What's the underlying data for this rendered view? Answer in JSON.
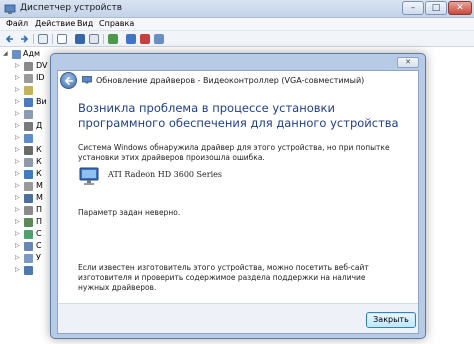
{
  "background_window": {
    "title": "Диспетчер устройств",
    "window_buttons": {
      "minimize": "–",
      "maximize": "□",
      "close": "✕"
    },
    "menu": [
      "Файл",
      "Действие",
      "Вид",
      "Справка"
    ],
    "tree": [
      {
        "label": "Адм",
        "expander": "◢"
      },
      {
        "label": "DV",
        "expander": "▷"
      },
      {
        "label": "ID",
        "expander": "▷"
      },
      {
        "label": "",
        "expander": "▷"
      },
      {
        "label": "Ви",
        "expander": "▷"
      },
      {
        "label": "",
        "expander": "▷"
      },
      {
        "label": "Д",
        "expander": "▷"
      },
      {
        "label": "",
        "expander": "▷"
      },
      {
        "label": "К",
        "expander": "▷"
      },
      {
        "label": "К",
        "expander": "▷"
      },
      {
        "label": "К",
        "expander": "▷"
      },
      {
        "label": "М",
        "expander": "▷"
      },
      {
        "label": "М",
        "expander": "▷"
      },
      {
        "label": "П",
        "expander": "▷"
      },
      {
        "label": "П",
        "expander": "▷"
      },
      {
        "label": "С",
        "expander": "▷"
      },
      {
        "label": "С",
        "expander": "▷"
      },
      {
        "label": "У",
        "expander": "▷"
      },
      {
        "label": "",
        "expander": "▷"
      }
    ]
  },
  "dialog": {
    "close_glyph": "✕",
    "caption": "Обновление драйверов - Видеоконтроллер (VGA-совместимый)",
    "main_instruction": "Возникла проблема в процессе установки программного обеспечения для данного устройства",
    "body": "Система Windows обнаружила драйвер для этого устройства, но при попытке установки этих драйверов произошла ошибка.",
    "device_name": "ATI Radeon HD 3600 Series",
    "error_message": "Параметр задан неверно.",
    "vendor_hint": "Если известен изготовитель этого устройства, можно посетить веб-сайт изготовителя и проверить содержимое раздела поддержки на наличие нужных драйверов.",
    "close_button": "Закрыть"
  },
  "colors": {
    "main_instruction": "#1e3f8a",
    "dialog_frame": "#b7cbe6",
    "button_border": "#3c7fb1"
  }
}
